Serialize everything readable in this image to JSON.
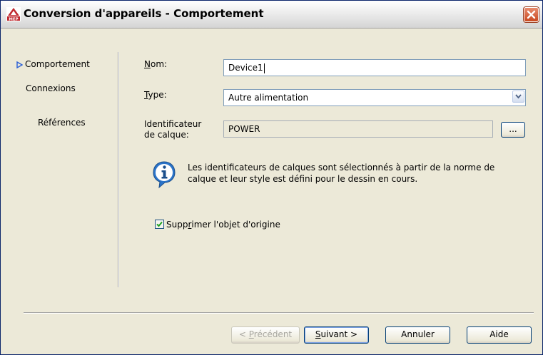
{
  "window": {
    "title": "Conversion d'appareils - Comportement",
    "app_icon": "autocad-mep-icon",
    "close_icon": "close-icon"
  },
  "nav": {
    "items": [
      {
        "label": "Comportement",
        "active": true
      },
      {
        "label": "Connexions",
        "active": false
      },
      {
        "label": "Références",
        "active": false
      }
    ],
    "active_indicator": "play-arrow-icon",
    "accent": "#2a5fd6"
  },
  "form": {
    "name": {
      "label_u": "N",
      "label_rest": "om:",
      "value": "Device1"
    },
    "type": {
      "label_u": "T",
      "label_rest": "ype:",
      "value": "Autre alimentation"
    },
    "layer_key": {
      "label_line1": "Identificateur",
      "label_line2_pre": "de calque:",
      "value": "POWER",
      "browse_label": "..."
    },
    "info_text": "Les identificateurs de calques sont sélectionnés à partir de la norme de calque et leur style est défini pour le dessin en cours.",
    "info_icon": "info-icon",
    "erase_original": {
      "label_pre": "Supp",
      "label_u": "r",
      "label_rest": "imer l'objet d'origine",
      "checked": true
    }
  },
  "buttons": {
    "back": {
      "label_pre": "< ",
      "label_u": "P",
      "label_rest": "récédent",
      "enabled": false
    },
    "next": {
      "label_u": "S",
      "label_rest": "uivant >",
      "enabled": true
    },
    "cancel": {
      "label": "Annuler"
    },
    "help": {
      "label": "Aide"
    }
  }
}
